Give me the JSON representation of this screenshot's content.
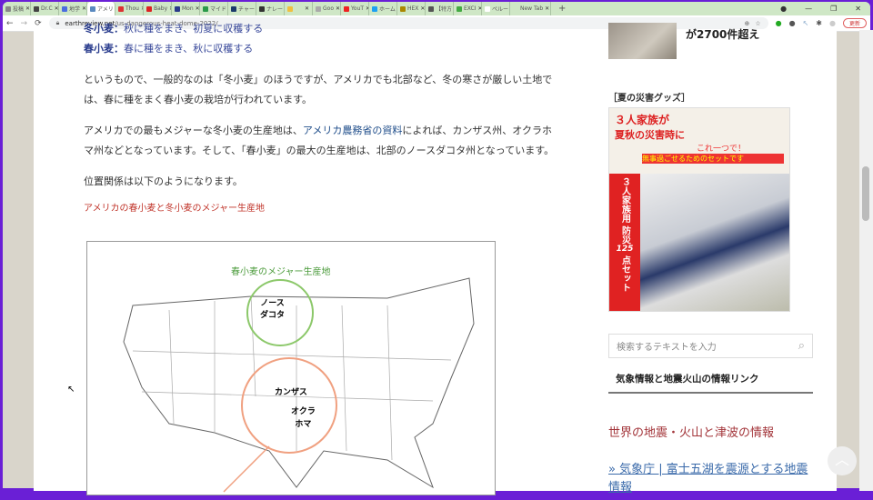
{
  "browser": {
    "tabs": [
      {
        "label": "投稿",
        "color": "#888"
      },
      {
        "label": "Dr.C",
        "color": "#444"
      },
      {
        "label": "地学",
        "color": "#4a6ee0"
      },
      {
        "label": "アメリ",
        "color": "#5a8ac0",
        "active": true
      },
      {
        "label": "Thou",
        "color": "#d33"
      },
      {
        "label": "Baby",
        "color": "#d22"
      },
      {
        "label": "Mon",
        "color": "#2a3a8a"
      },
      {
        "label": "マイド",
        "color": "#2a9a4a"
      },
      {
        "label": "チャー",
        "color": "#1a3a6a"
      },
      {
        "label": "ナレー",
        "color": "#333"
      },
      {
        "label": "",
        "color": "#f0c040"
      },
      {
        "label": "Goo",
        "color": "#aaa"
      },
      {
        "label": "YouT",
        "color": "#e22"
      },
      {
        "label": "ホーム",
        "color": "#1da1f2"
      },
      {
        "label": "HEX",
        "color": "#a80"
      },
      {
        "label": "【特方",
        "color": "#555"
      },
      {
        "label": "EXCI",
        "color": "#4a4"
      },
      {
        "label": "ペルー",
        "color": "#fff"
      },
      {
        "label": "New Tab",
        "color": "#cfe7c6"
      }
    ],
    "url_domain": "earthreview.net",
    "url_path": "/us-dangerous-heat-dome-2022/",
    "update_label": "更新"
  },
  "article": {
    "winter_label": "冬小麦：",
    "winter_text": "秋に種をまき、初夏に収穫する",
    "spring_label": "春小麦：",
    "spring_text": "春に種をまき、秋に収穫する",
    "p1": "というもので、一般的なのは「冬小麦」のほうですが、アメリカでも北部など、冬の寒さが厳しい土地では、春に種をまく春小麦の栽培が行われています。",
    "p2a": "アメリカでの最もメジャーな冬小麦の生産地は、",
    "p2link": "アメリカ農務省の資料",
    "p2b": "によれば、カンザス州、オクラホマ州などとなっています。そして、「春小麦」の最大の生産地は、北部のノースダコタ州となっています。",
    "p3": "位置関係は以下のようになります。",
    "caption": "アメリカの春小麦と冬小麦のメジャー生産地",
    "map": {
      "title": "春小麦のメジャー生産地",
      "nd": "ノース\nダコタ",
      "ks": "カンザス",
      "ok": "オクラ\nホマ"
    }
  },
  "sidebar": {
    "prev_title": "が2700件超え",
    "goods_heading": "［夏の災害グッズ］",
    "ad": {
      "line1": "３人家族が",
      "line2": "夏秋の災害時に",
      "line3": "これ一つで！",
      "line4": "無事過ごせるためのセットです",
      "vertical": "３人家族用 防災",
      "count": "125",
      "unit": "点セット"
    },
    "search_placeholder": "検索するテキストを入力",
    "links_heading": "気象情報と地震火山の情報リンク",
    "link1": "世界の地震・火山と津波の情報",
    "link2": "» 気象庁 | 富士五湖を震源とする地震情報"
  }
}
